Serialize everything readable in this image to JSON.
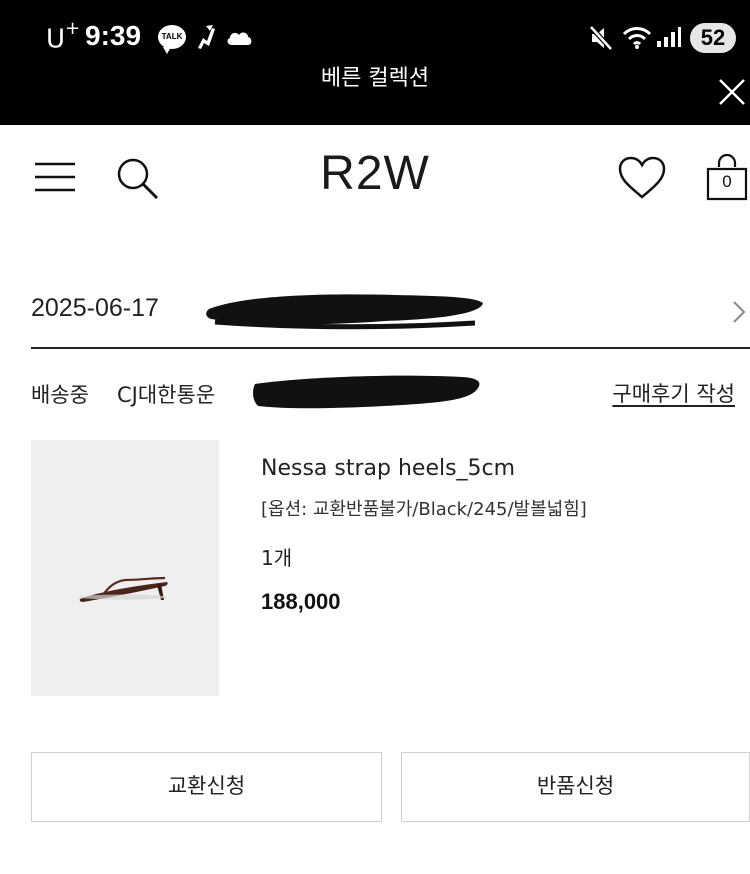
{
  "status_bar": {
    "carrier": "U",
    "carrier_sup": "+",
    "time": "9:39",
    "talk_label": "TALK",
    "battery": "52"
  },
  "webview": {
    "title": "베른 컬렉션"
  },
  "header": {
    "logo": "R2W",
    "cart_count": "0"
  },
  "order": {
    "date": "2025-06-17",
    "status": "배송중",
    "courier": "CJ대한통운",
    "review_link": "구매후기 작성"
  },
  "product": {
    "name": "Nessa strap heels_5cm",
    "option": "[옵션: 교환반품불가/Black/245/발볼넓힘]",
    "quantity": "1개",
    "price": "188,000",
    "image_icon": "strap-sandal-image"
  },
  "actions": {
    "exchange": "교환신청",
    "return": "반품신청"
  }
}
